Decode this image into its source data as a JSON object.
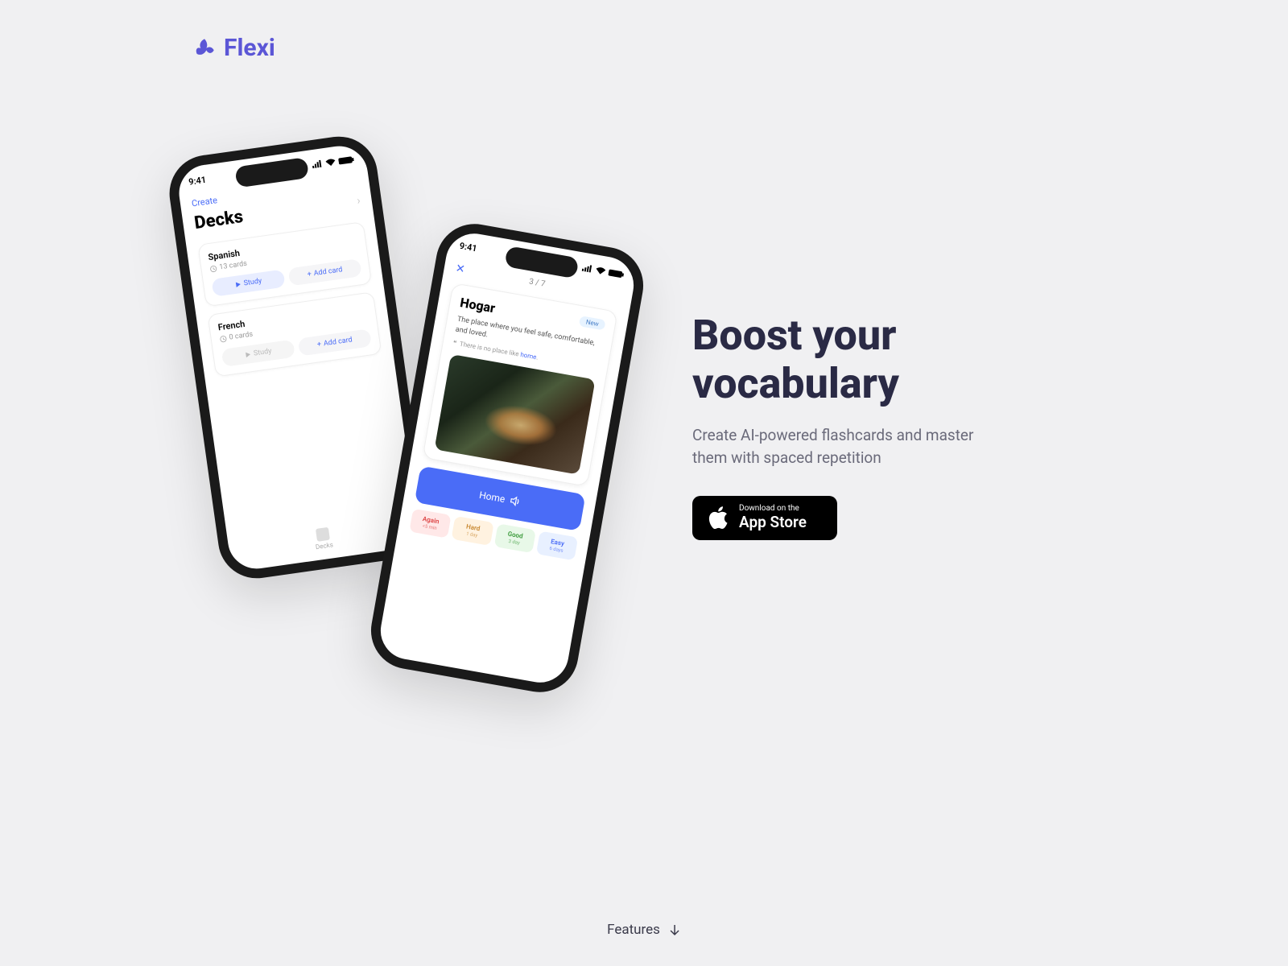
{
  "brand": {
    "name": "Flexi"
  },
  "hero": {
    "title": "Boost your vocabulary",
    "description": "Create AI-powered flashcards and master them with spaced repetition"
  },
  "appstore": {
    "line1": "Download on the",
    "line2": "App Store"
  },
  "features_link": "Features",
  "phone1": {
    "time": "9:41",
    "create_link": "Create",
    "title": "Decks",
    "decks": [
      {
        "name": "Spanish",
        "count": "13 cards",
        "study": "Study",
        "add": "Add card"
      },
      {
        "name": "French",
        "count": "0 cards",
        "study": "Study",
        "add": "Add card"
      }
    ],
    "tab": "Decks"
  },
  "phone2": {
    "time": "9:41",
    "progress": "3 / 7",
    "word": "Hogar",
    "badge": "New",
    "description": "The place where you feel safe, comfortable, and loved.",
    "example_prefix": "There is no place like ",
    "example_highlight": "home",
    "example_suffix": ".",
    "answer": "Home",
    "buttons": [
      {
        "label": "Again",
        "time": "<5 min"
      },
      {
        "label": "Hard",
        "time": "1 day"
      },
      {
        "label": "Good",
        "time": "3 day"
      },
      {
        "label": "Easy",
        "time": "6 days"
      }
    ]
  }
}
